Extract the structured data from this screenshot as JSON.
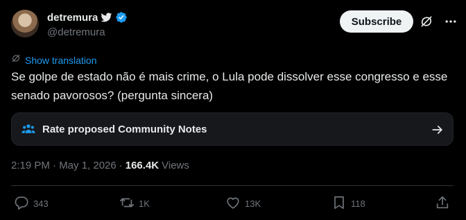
{
  "author": {
    "display_name": "detremura",
    "handle": "@detremura"
  },
  "header": {
    "subscribe_label": "Subscribe"
  },
  "translation": {
    "label": "Show translation"
  },
  "tweet": {
    "text": "Se golpe de estado não é mais crime, o Lula pode dissolver esse congresso e esse senado pavorosos? (pergunta sincera)"
  },
  "community_notes": {
    "label": "Rate proposed Community Notes"
  },
  "meta": {
    "timestamp": "2:19 PM · May 1, 2026",
    "separator": "·",
    "views_count": "166.4K",
    "views_label": "Views"
  },
  "actions": {
    "replies": "343",
    "reposts": "1K",
    "likes": "13K",
    "bookmarks": "118"
  },
  "colors": {
    "background": "#000000",
    "accent": "#1d9bf0",
    "text_primary": "#e7e9ea",
    "text_secondary": "#71767b"
  }
}
